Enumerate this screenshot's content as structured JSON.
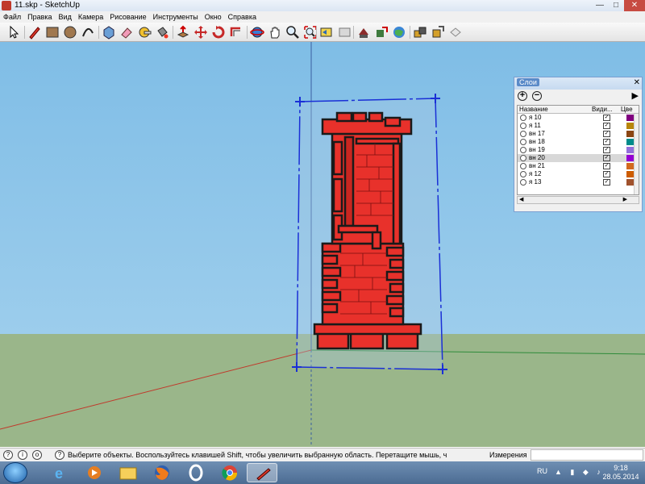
{
  "window": {
    "title": "11.skp - SketchUp"
  },
  "menu": [
    "Файл",
    "Правка",
    "Вид",
    "Камера",
    "Рисование",
    "Инструменты",
    "Окно",
    "Справка"
  ],
  "toolbar": {
    "tools": [
      "select-icon",
      "pencil-icon",
      "rectangle-icon",
      "circle-icon",
      "arc-icon",
      "make-component-icon",
      "eraser-icon",
      "tape-measure-icon",
      "paint-bucket-icon",
      "push-pull-icon",
      "move-icon",
      "rotate-icon",
      "offset-icon",
      "orbit-icon",
      "pan-icon",
      "zoom-icon",
      "zoom-extents-icon",
      "previous-view-icon",
      "next-view-icon",
      "3d-warehouse-icon",
      "share-model-icon",
      "google-earth-icon",
      "get-models-icon",
      "share-component-icon",
      "extension-icon"
    ]
  },
  "layers_panel": {
    "title": "Слои",
    "columns": {
      "name": "Название",
      "visible": "Види...",
      "color": "Цве"
    },
    "rows": [
      {
        "name": "я 10",
        "visible": true,
        "color": "#800080",
        "selected": false
      },
      {
        "name": "я 11",
        "visible": true,
        "color": "#b8860b",
        "selected": false
      },
      {
        "name": "вн 17",
        "visible": true,
        "color": "#8b4513",
        "selected": false
      },
      {
        "name": "вн 18",
        "visible": true,
        "color": "#008b8b",
        "selected": false
      },
      {
        "name": "вн 19",
        "visible": true,
        "color": "#9370db",
        "selected": false
      },
      {
        "name": "вн 20",
        "visible": true,
        "color": "#9400d3",
        "selected": true
      },
      {
        "name": "вн 21",
        "visible": true,
        "color": "#d2691e",
        "selected": false
      },
      {
        "name": "я 12",
        "visible": true,
        "color": "#cd5c00",
        "selected": false
      },
      {
        "name": "я 13",
        "visible": true,
        "color": "#a0522d",
        "selected": false
      }
    ]
  },
  "statusbar": {
    "hint": "Выберите объекты. Воспользуйтесь клавишей Shift, чтобы увеличить выбранную область. Перетащите мышь, ч",
    "measurements_label": "Измерения",
    "measurements_value": ""
  },
  "taskbar": {
    "apps": [
      "ie-icon",
      "media-player-icon",
      "file-explorer-icon",
      "firefox-icon",
      "opera-icon",
      "chrome-icon",
      "sketchup-icon"
    ],
    "language": "RU",
    "time": "9:18",
    "date": "28.05.2014"
  },
  "colors": {
    "brick": "#e8312b",
    "mortar": "#222222",
    "selection": "#1a2fd6",
    "sky": "#83bfe6",
    "ground": "#9ab68a"
  }
}
